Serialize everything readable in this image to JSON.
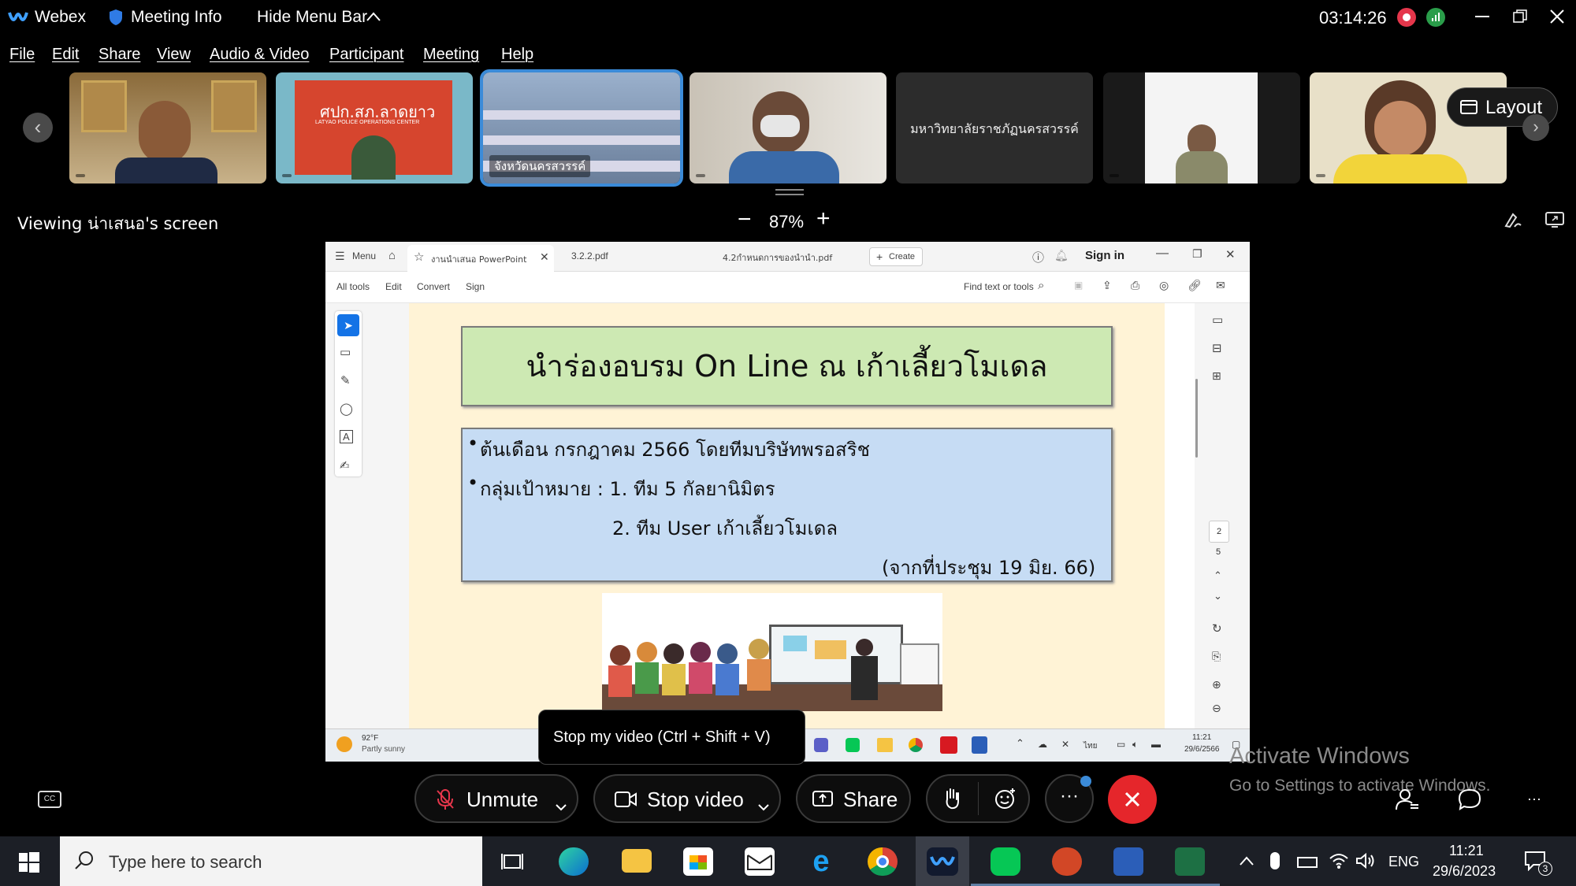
{
  "titlebar": {
    "app_name": "Webex",
    "meeting_info": "Meeting Info",
    "hide_menu_bar": "Hide Menu Bar",
    "timer": "03:14:26"
  },
  "menu": [
    "File",
    "Edit",
    "Share",
    "View",
    "Audio & Video",
    "Participant",
    "Meeting",
    "Help"
  ],
  "thumbnails": [
    {
      "name": ""
    },
    {
      "name": "",
      "sign": "ศปก.สภ.ลาดยาว",
      "sign2": "LATYAO POLICE OPERATIONS CENTER"
    },
    {
      "name": "จังหวัดนครสวรรค์"
    },
    {
      "name": ""
    },
    {
      "name": "มหาวิทยาลัยราชภัฏนครสวรรค์"
    },
    {
      "name": ""
    },
    {
      "name": ""
    }
  ],
  "layout_button": "Layout",
  "viewing": {
    "label": "Viewing น่าเสนอ's screen",
    "zoom": "87%"
  },
  "acrobat": {
    "menu": "Menu",
    "tab_active": "งานนำเสนอ PowerPoint",
    "tab2": "3.2.2.pdf",
    "tab3": "4.2กำหนดการของนำนำ.pdf",
    "create": "Create",
    "signin": "Sign in",
    "tools": [
      "All tools",
      "Edit",
      "Convert",
      "Sign"
    ],
    "find": "Find text or tools",
    "page_current": "2",
    "page_total": "5"
  },
  "slide": {
    "title": "นำร่องอบรม On Line ณ เก้าเลี้ยวโมเดล",
    "line1": "ต้นเดือน กรกฎาคม 2566 โดยทีมบริษัทพรอสริช",
    "line2": "กลุ่มเป้าหมาย : 1. ทีม 5 กัลยานิมิตร",
    "line3": "2. ทีม User เก้าเลี้ยวโมเดล",
    "line4": "(จากที่ประชุม 19 มิย. 66)"
  },
  "inner_taskbar": {
    "weather_temp": "92°F",
    "weather_desc": "Partly sunny",
    "lang": "ไทย",
    "time": "11:21",
    "date": "29/6/2566"
  },
  "tooltip": "Stop my video (Ctrl + Shift + V)",
  "controls": {
    "unmute": "Unmute",
    "stop_video": "Stop video",
    "share": "Share"
  },
  "watermark": {
    "line1": "Activate Windows",
    "line2": "Go to Settings to activate Windows."
  },
  "windows": {
    "search_placeholder": "Type here to search",
    "lang": "ENG",
    "time": "11:21",
    "date": "29/6/2023",
    "notif_count": "3"
  },
  "colors": {
    "accent_blue": "#3b8bd8",
    "end_red": "#e5262b",
    "slide_bg": "#fff3d6",
    "title_green": "#cde9b3",
    "body_blue": "#c6dcf4"
  }
}
